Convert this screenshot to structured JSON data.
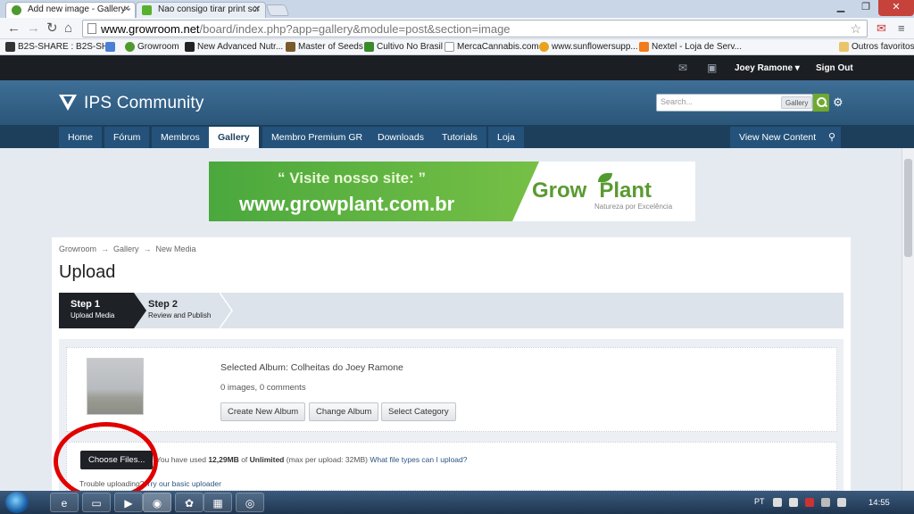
{
  "browser": {
    "tabs": [
      {
        "title": "Add new image - Gallery -",
        "active": true
      },
      {
        "title": "Nao consigo tirar print scr",
        "active": false
      }
    ],
    "url_domain": "www.growroom.net",
    "url_path": "/board/index.php?app=gallery&module=post&section=image",
    "bookmarks": [
      "B2S-SHARE : B2S-SH...",
      "Growroom",
      "New Advanced Nutr...",
      "Master of Seeds",
      "Cultivo No Brasil",
      "MercaCannabis.com",
      "www.sunflowersupp...",
      "Nextel - Loja de Serv..."
    ],
    "other_bookmarks": "Outros favoritos"
  },
  "userbar": {
    "username": "Joey Ramone",
    "signout": "Sign Out"
  },
  "branding": {
    "logo_text": "IPS Community",
    "search_placeholder": "Search...",
    "search_scope": "Gallery"
  },
  "nav": {
    "tabs": [
      "Home",
      "Fórum",
      "Membros",
      "Gallery",
      "Membro Premium GR",
      "Downloads",
      "Tutorials",
      "Loja"
    ],
    "active": "Gallery",
    "view_new": "View New Content"
  },
  "banner": {
    "quote": "“ Visite nosso site: ”",
    "url": "www.growplant.com.br",
    "brand_a": "Grow",
    "brand_b": "Plant",
    "tagline": "Natureza por Excelência"
  },
  "page": {
    "breadcrumb": [
      "Growroom",
      "Gallery",
      "New Media"
    ],
    "breadcrumb_sep": "→",
    "title": "Upload",
    "steps": [
      {
        "num": "Step 1",
        "label": "Upload Media"
      },
      {
        "num": "Step 2",
        "label": "Review and Publish"
      }
    ],
    "album_line": "Selected Album: Colheitas do Joey Ramone",
    "album_counts": "0 images, 0 comments",
    "album_buttons": [
      "Create New Album",
      "Change Album",
      "Select Category"
    ],
    "choose_files": "Choose Files...",
    "usage_prefix": "You have used",
    "usage_used": "12,29MB",
    "usage_of": "of",
    "usage_limit": "Unlimited",
    "usage_suffix": "(max per upload: 32MB)",
    "usage_link": "What file types can I upload?",
    "trouble_prefix": "Trouble uploading?",
    "trouble_link": "Try our basic uploader"
  },
  "taskbar": {
    "language": "PT",
    "clock": "14:55"
  },
  "colors": {
    "brand_blue": "#2a5679",
    "nav_dark": "#1d3f5c",
    "annotation_red": "#e00000",
    "search_green": "#6faa2f"
  }
}
